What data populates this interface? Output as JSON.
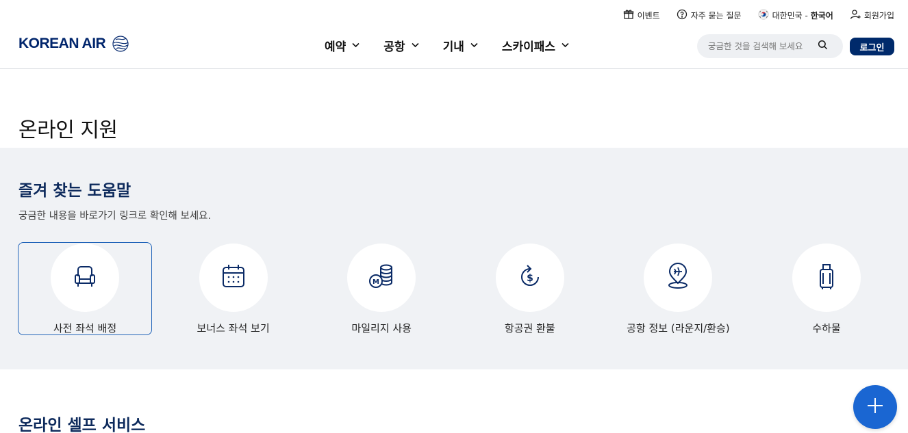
{
  "header": {
    "logo_text": "KOREAN AIR",
    "utility": {
      "event": "이벤트",
      "faq": "자주 묻는 질문",
      "country": "대한민국",
      "separator": " - ",
      "language": "한국어",
      "signup": "회원가입"
    },
    "nav": [
      "예약",
      "공항",
      "기내",
      "스카이패스"
    ],
    "search_placeholder": "궁금한 것을 검색해 보세요",
    "login": "로그인"
  },
  "page_title": "온라인 지원",
  "favorites": {
    "title": "즐겨 찾는 도움말",
    "description": "궁금한 내용을 바로가기 링크로 확인해 보세요.",
    "items": [
      {
        "label": "사전 좌석 배정",
        "icon": "seat-icon",
        "active": true
      },
      {
        "label": "보너스 좌석 보기",
        "icon": "calendar-icon",
        "active": false
      },
      {
        "label": "마일리지 사용",
        "icon": "mileage-coins-icon",
        "active": false
      },
      {
        "label": "항공권 환불",
        "icon": "refund-icon",
        "active": false
      },
      {
        "label": "공항 정보 (라운지/환승)",
        "icon": "airport-pin-icon",
        "active": false
      },
      {
        "label": "수하물",
        "icon": "luggage-icon",
        "active": false
      }
    ]
  },
  "self_service": {
    "title": "온라인 셀프 서비스"
  },
  "colors": {
    "brand_navy": "#002a6b",
    "title_navy": "#0d2a5c",
    "icon_navy": "#0a2a66",
    "fab_blue": "#1a66d2",
    "section_bg": "#f0f2f5",
    "active_border": "#1f63b8"
  }
}
